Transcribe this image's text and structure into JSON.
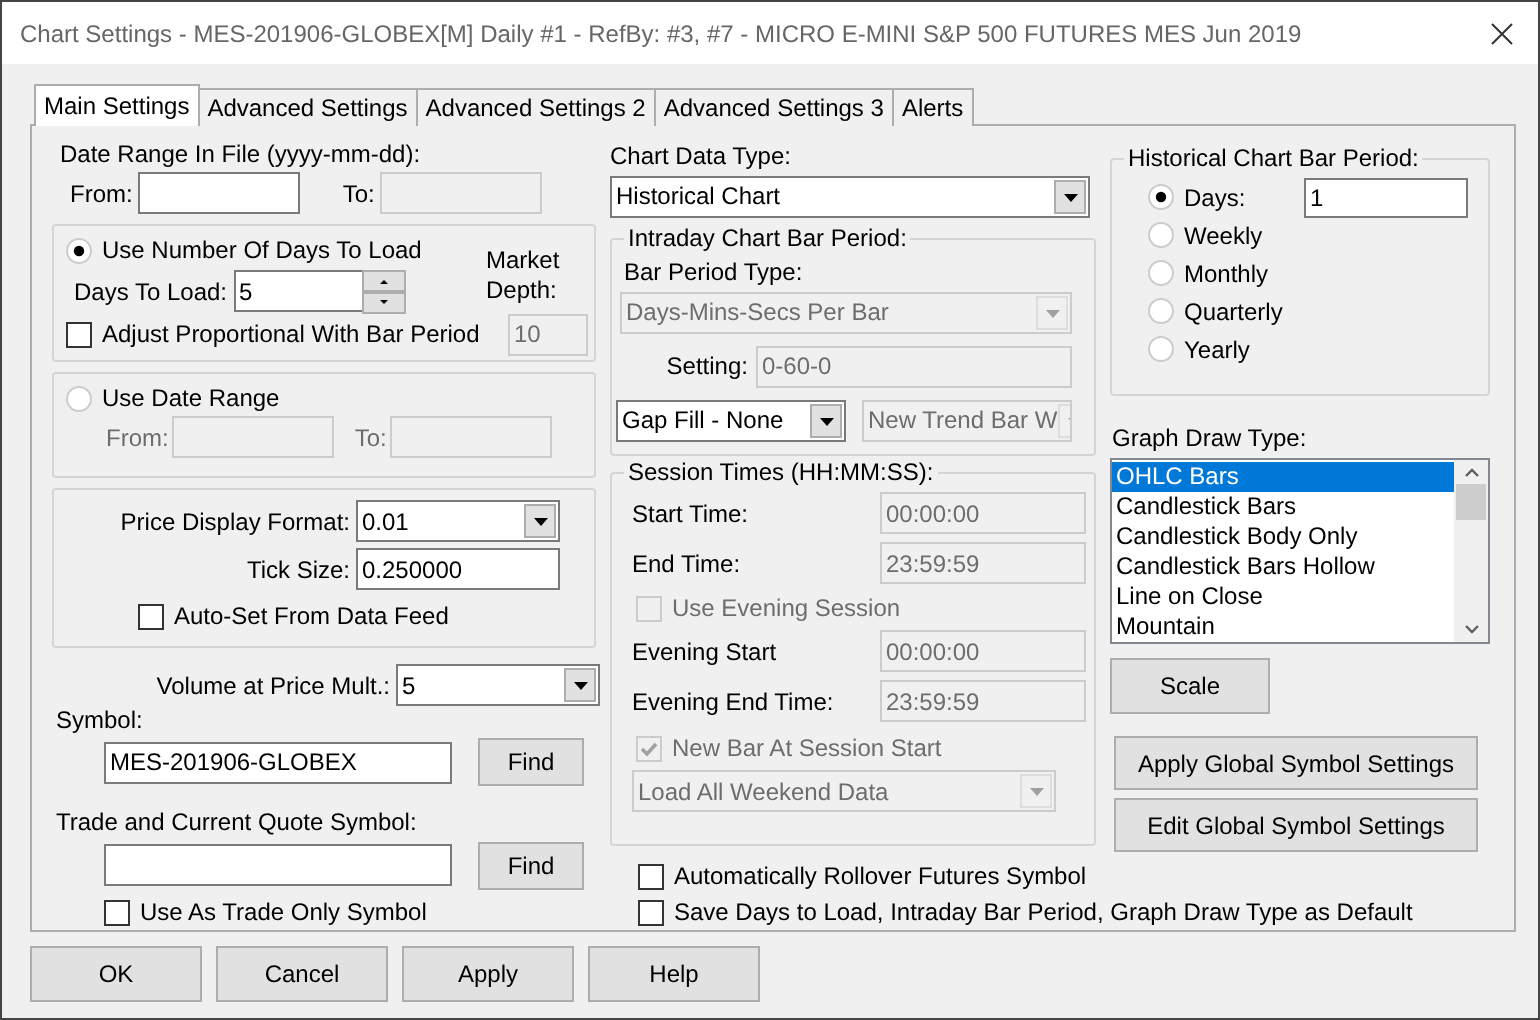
{
  "window": {
    "title": "Chart Settings - MES-201906-GLOBEX[M]  Daily  #1 - RefBy: #3, #7 - MICRO E-MINI S&P 500 FUTURES MES Jun 2019"
  },
  "tabs": [
    {
      "label": "Main Settings",
      "selected": true
    },
    {
      "label": "Advanced Settings",
      "selected": false
    },
    {
      "label": "Advanced Settings 2",
      "selected": false
    },
    {
      "label": "Advanced Settings 3",
      "selected": false
    },
    {
      "label": "Alerts",
      "selected": false
    }
  ],
  "date_range": {
    "label": "Date Range In File (yyyy-mm-dd):",
    "from_label": "From:",
    "to_label": "To:",
    "to_disabled": true
  },
  "days_group": {
    "radio": {
      "label": "Use Number Of Days To Load",
      "selected": true
    },
    "days_label": "Days To Load:",
    "days_value": "5",
    "adjust": {
      "label": "Adjust Proportional With Bar Period",
      "checked": false
    },
    "depth_label": "Market Depth:",
    "depth_value": "10",
    "depth_disabled": true
  },
  "date_group": {
    "radio": {
      "label": "Use Date Range",
      "selected": false
    },
    "from_label": "From:",
    "to_label": "To:",
    "disabled": true
  },
  "price_group": {
    "format_label": "Price Display Format:",
    "format_value": "0.01",
    "tick_label": "Tick Size:",
    "tick_value": "0.250000",
    "autoset": {
      "label": "Auto-Set From Data Feed",
      "checked": false
    }
  },
  "volume": {
    "label": "Volume at Price Mult.:",
    "value": "5"
  },
  "symbol": {
    "label": "Symbol:",
    "value": "MES-201906-GLOBEX",
    "button": "Find"
  },
  "trade_symbol": {
    "label": "Trade and Current Quote Symbol:",
    "button": "Find",
    "trade_only": {
      "label": "Use As Trade Only Symbol",
      "checked": false
    }
  },
  "chart_data_type": {
    "label": "Chart Data Type:",
    "value": "Historical Chart"
  },
  "intraday": {
    "title": "Intraday Chart Bar Period:",
    "bar_period_label": "Bar Period Type:",
    "bar_period_value": "Days-Mins-Secs Per Bar",
    "setting_label": "Setting:",
    "setting_value": "0-60-0",
    "gap_fill": "Gap Fill - None",
    "new_trend": "New Trend Bar W",
    "disabled": true
  },
  "session": {
    "title": "Session Times (HH:MM:SS):",
    "times": [
      {
        "label": "Start Time:",
        "value": "00:00:00",
        "disabled": true
      },
      {
        "label": "End Time:",
        "value": "23:59:59",
        "disabled": true
      }
    ],
    "evening": {
      "label": "Use Evening Session",
      "checked": false,
      "disabled": true
    },
    "evening_times": [
      {
        "label": "Evening Start",
        "value": "00:00:00",
        "disabled": true
      },
      {
        "label": "Evening End Time:",
        "value": "23:59:59",
        "disabled": true
      }
    ],
    "new_bar": {
      "label": "New Bar At Session Start",
      "checked": true,
      "disabled": true
    },
    "weekend": {
      "value": "Load All Weekend Data",
      "disabled": true
    }
  },
  "options": [
    {
      "label": "Automatically Rollover Futures Symbol",
      "checked": false
    },
    {
      "label": "Save Days to Load, Intraday Bar Period, Graph Draw Type as Default",
      "checked": false
    }
  ],
  "historical": {
    "title": "Historical Chart Bar Period:",
    "days_value": "1",
    "periods": [
      {
        "label": "Days:",
        "selected": true
      },
      {
        "label": "Weekly",
        "selected": false
      },
      {
        "label": "Monthly",
        "selected": false
      },
      {
        "label": "Quarterly",
        "selected": false
      },
      {
        "label": "Yearly",
        "selected": false
      }
    ]
  },
  "graph_draw": {
    "label": "Graph Draw Type:",
    "items": [
      {
        "label": "OHLC Bars",
        "selected": true
      },
      {
        "label": "Candlestick Bars",
        "selected": false
      },
      {
        "label": "Candlestick Body Only",
        "selected": false
      },
      {
        "label": "Candlestick Bars Hollow",
        "selected": false
      },
      {
        "label": "Line on Close",
        "selected": false
      },
      {
        "label": "Mountain",
        "selected": false
      }
    ]
  },
  "scale_button": "Scale",
  "global_buttons": [
    "Apply Global Symbol Settings",
    "Edit Global Symbol Settings"
  ],
  "buttons": [
    "OK",
    "Cancel",
    "Apply",
    "Help"
  ]
}
